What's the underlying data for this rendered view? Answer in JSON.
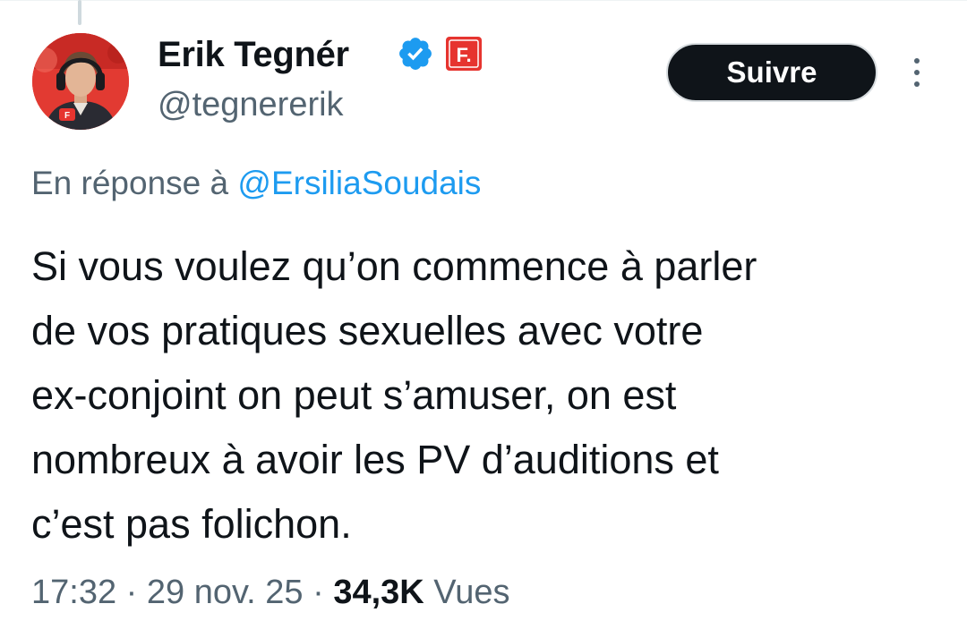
{
  "author": {
    "display_name": "Erik Tegnér",
    "handle": "@tegnererik",
    "verified": true,
    "affiliate_badge_letter": "F."
  },
  "follow_button": {
    "label": "Suivre"
  },
  "reply_context": {
    "prefix": "En réponse à",
    "mention": "@ErsiliaSoudais"
  },
  "tweet": {
    "lines": [
      "Si vous voulez qu’on commence à parler",
      "de vos pratiques sexuelles avec votre",
      "ex-conjoint on peut s’amuser, on est",
      "nombreux à avoir les PV d’auditions et",
      "c’est pas folichon."
    ]
  },
  "meta": {
    "time": "17:32",
    "separator": "·",
    "date": "29 nov. 25",
    "views_count": "34,3K",
    "views_label": "Vues"
  },
  "colors": {
    "text_primary": "#0f1419",
    "text_secondary": "#536471",
    "link": "#1d9bf0",
    "verified": "#1d9bf0",
    "affiliate_red": "#e6342f",
    "button_bg": "#0f1419"
  },
  "icons": {
    "verified": "verified-badge-icon",
    "affiliate": "affiliate-logo-icon",
    "more": "more-vertical-icon"
  }
}
